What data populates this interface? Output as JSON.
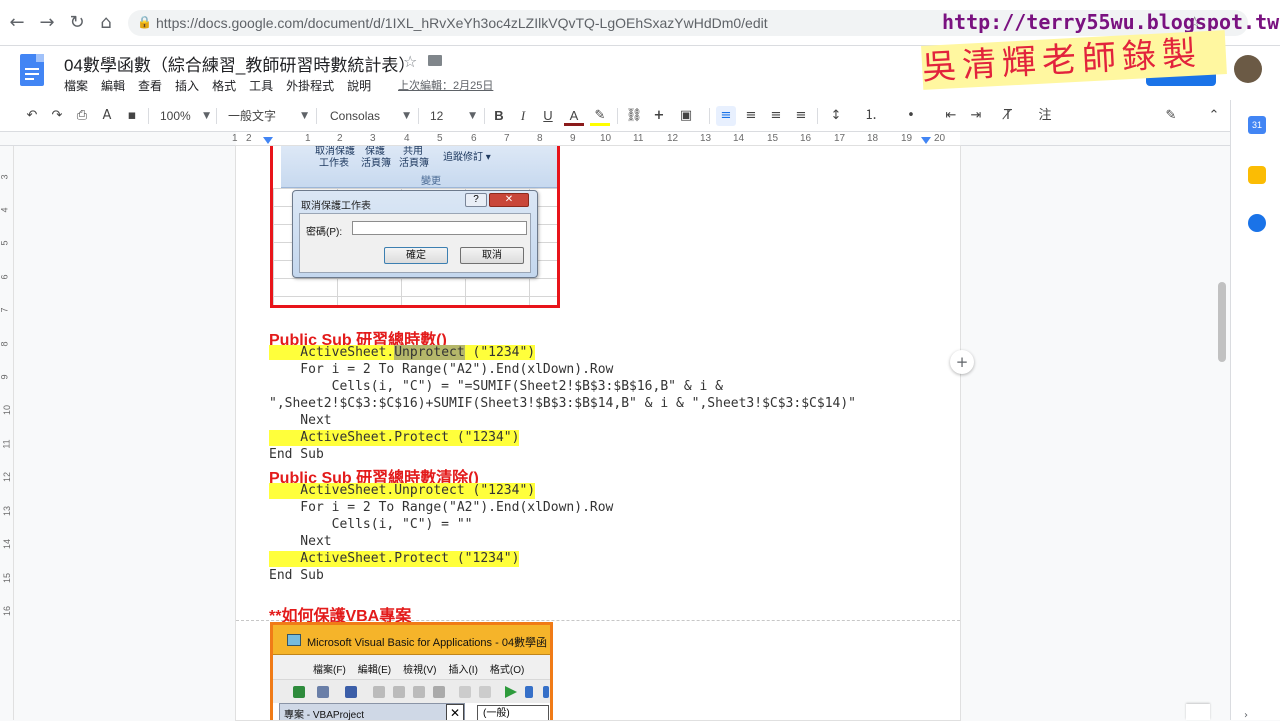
{
  "browser": {
    "url": "https://docs.google.com/document/d/1IXL_hRvXeYh3oc4zLZIlkVQvTQ-LgOEhSxazYwHdDm0/edit",
    "nav_back": "←",
    "nav_forward": "→",
    "nav_reload": "↻",
    "nav_home": "⌂",
    "lock": "🔒",
    "bookmark_star": "☆"
  },
  "watermark": {
    "url": "http://terry55wu.blogspot.tw",
    "name": "吳清輝老師錄製"
  },
  "doc": {
    "title": "04數學函數（綜合練習_教師研習時數統計表）",
    "title_star": "☆",
    "last_edit": "上次編輯：2月25日",
    "menu": [
      "檔案",
      "編輯",
      "查看",
      "插入",
      "格式",
      "工具",
      "外掛程式",
      "說明"
    ]
  },
  "toolbar": {
    "undo": "↶",
    "redo": "↷",
    "print": "⎙",
    "spell": "A",
    "paint": "▪",
    "zoom": "100%",
    "style": "一般文字",
    "font": "Consolas",
    "size": "12",
    "bold": "B",
    "italic": "I",
    "underline": "U",
    "text_color": "A",
    "highlight": "✎",
    "link": "⛓",
    "comment": "+",
    "image": "▣",
    "align_left": "≡",
    "align_center": "≡",
    "align_right": "≡",
    "align_justify": "≡",
    "line_spacing": "↕",
    "numbered_list": "⒈",
    "bullet_list": "•",
    "decrease_indent": "⇤",
    "increase_indent": "⇥",
    "clear_format": "T̸",
    "input_tools": "注",
    "edit_mode": "✎",
    "collapse": "⌃"
  },
  "ruler": {
    "ticks": [
      "1",
      "2",
      "1",
      "2",
      "3",
      "4",
      "5",
      "6",
      "7",
      "8",
      "9",
      "10",
      "11",
      "12",
      "13",
      "14",
      "15",
      "16",
      "17",
      "18",
      "19",
      "20"
    ],
    "vticks": [
      "3",
      "4",
      "5",
      "6",
      "7",
      "8",
      "9",
      "10",
      "11",
      "12",
      "13",
      "14",
      "15",
      "16"
    ]
  },
  "excel_image": {
    "ribbon_items": [
      "取消保護",
      "保護",
      "共用",
      "工作表",
      "活頁簿",
      "活頁簿",
      "追蹤修訂 ▾",
      "變更"
    ],
    "dialog_title": "取消保護工作表",
    "help": "?",
    "close": "✕",
    "password_label": "密碼(P):",
    "ok": "確定",
    "cancel": "取消"
  },
  "code": {
    "heading1": "Public Sub 研習總時數()",
    "l1a": "    ActiveSheet.",
    "l1b": "Unprotect",
    "l1c": " (\"1234\")",
    "l2": "    For i = 2 To Range(\"A2\").End(xlDown).Row",
    "l3": "        Cells(i, \"C\") = \"=SUMIF(Sheet2!$B$3:$B$16,B\" & i &",
    "l4": "\",Sheet2!$C$3:$C$16)+SUMIF(Sheet3!$B$3:$B$14,B\" & i & \",Sheet3!$C$3:$C$14)\"",
    "l5": "    Next",
    "l6": "    ActiveSheet.Protect (\"1234\")",
    "l7": "End Sub",
    "heading2": "Public Sub 研習總時數清除()",
    "m1": "    ActiveSheet.Unprotect (\"1234\")",
    "m2": "    For i = 2 To Range(\"A2\").End(xlDown).Row",
    "m3": "        Cells(i, \"C\") = \"\"",
    "m4": "    Next",
    "m5": "    ActiveSheet.Protect (\"1234\")",
    "m6": "End Sub",
    "heading3": "**如何保護VBA專案"
  },
  "vba_image": {
    "title": "Microsoft Visual Basic for Applications - 04數學函",
    "menu": [
      "檔案(F)",
      "編輯(E)",
      "檢視(V)",
      "插入(I)",
      "格式(O)"
    ],
    "project_pane": "專案 - VBAProject",
    "close": "✕",
    "combo": "(一般)"
  },
  "side": {
    "add_comment": "+",
    "calendar": "31"
  },
  "colors": {
    "accent": "#1a73e8",
    "heading_red": "#e31b1b",
    "highlight": "#ffff3b",
    "watermark_purple": "#7a1280"
  }
}
